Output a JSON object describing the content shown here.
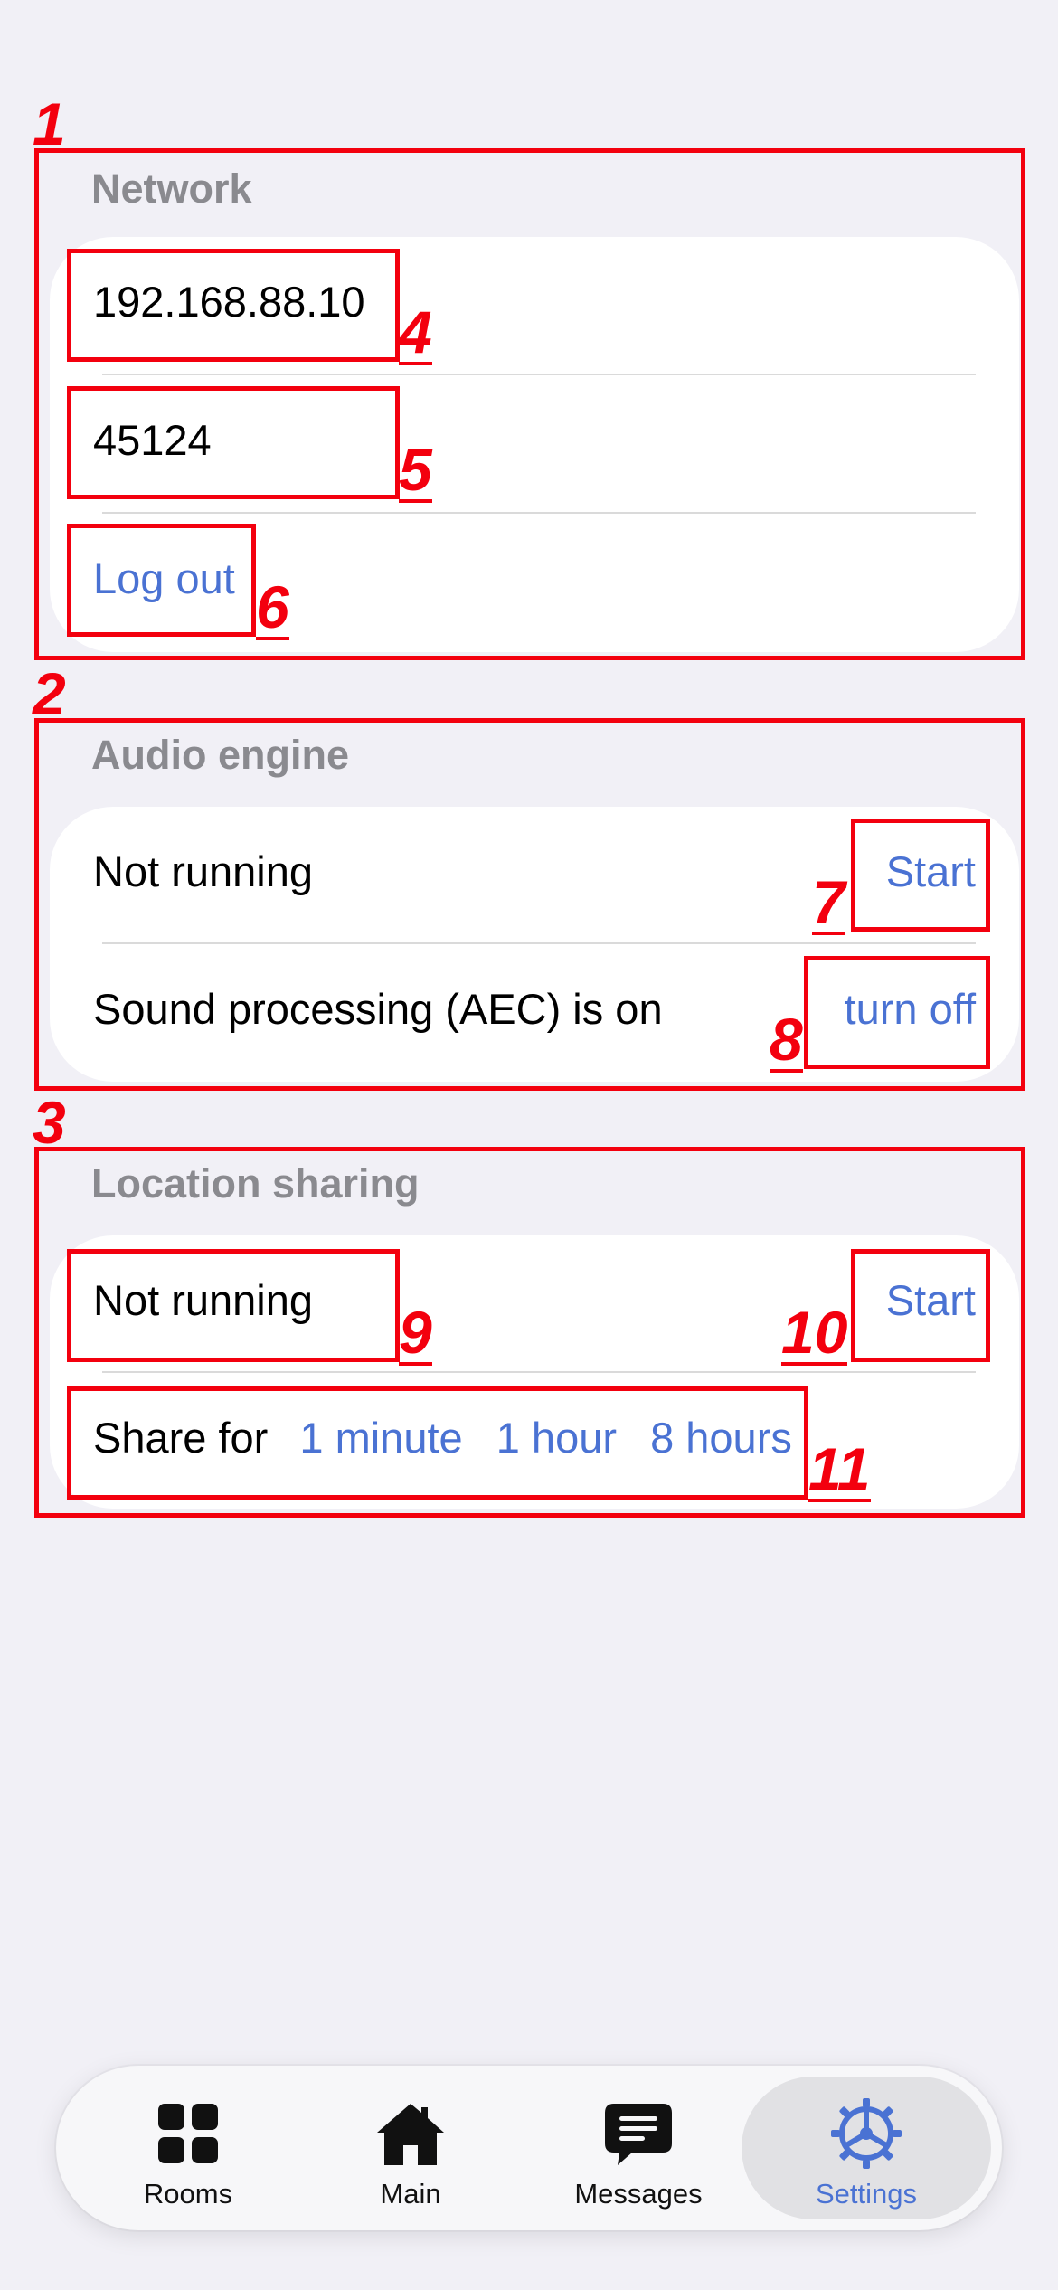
{
  "annotations": [
    "1",
    "2",
    "3",
    "4",
    "5",
    "6",
    "7",
    "8",
    "9",
    "10",
    "11"
  ],
  "network": {
    "header": "Network",
    "server_address": "192.168.88.10",
    "port": "45124",
    "logout_label": "Log out"
  },
  "audio": {
    "header": "Audio engine",
    "status": "Not running",
    "start_label": "Start",
    "aec_status": "Sound processing (AEC) is on",
    "aec_toggle_label": "turn off"
  },
  "location": {
    "header": "Location sharing",
    "status": "Not running",
    "start_label": "Start",
    "share_label": "Share for",
    "options": [
      "1 minute",
      "1 hour",
      "8 hours"
    ]
  },
  "tabbar": {
    "tabs": [
      {
        "label": "Rooms",
        "icon": "grid-icon"
      },
      {
        "label": "Main",
        "icon": "home-icon"
      },
      {
        "label": "Messages",
        "icon": "message-icon"
      },
      {
        "label": "Settings",
        "icon": "gear-icon"
      }
    ],
    "active": "Settings"
  },
  "colors": {
    "accent": "#4a72d3",
    "background": "#f1f0f6",
    "annotation": "#f3000e",
    "section_header": "#8a8a8f"
  }
}
